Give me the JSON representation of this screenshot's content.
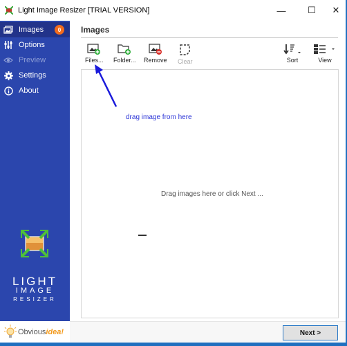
{
  "window": {
    "title": "Light Image Resizer  [TRIAL VERSION]",
    "controls": {
      "minimize": "—",
      "maximize": "☐",
      "close": "✕"
    }
  },
  "sidebar": {
    "items": [
      {
        "label": "Images",
        "icon": "images-icon",
        "active": true,
        "badge": "0"
      },
      {
        "label": "Options",
        "icon": "sliders-icon"
      },
      {
        "label": "Preview",
        "icon": "eye-icon",
        "disabled": true
      },
      {
        "label": "Settings",
        "icon": "gear-icon"
      },
      {
        "label": "About",
        "icon": "info-icon"
      }
    ],
    "logo": {
      "line1": "LIGHT",
      "line2": "IMAGE",
      "line3": "RESIZER"
    },
    "brand": {
      "part1": "Obvious",
      "part2": "idea!"
    }
  },
  "main": {
    "title": "Images",
    "toolbar": {
      "files": "Files...",
      "folder": "Folder...",
      "remove": "Remove",
      "clear": "Clear",
      "sort": "Sort",
      "view": "View"
    },
    "drop_message": "Drag images here or click Next ...",
    "annotation": "drag image from here",
    "next_label": "Next >"
  },
  "colors": {
    "sidebar": "#2b46ad",
    "sidebar_active": "#22338a",
    "badge": "#f26b1d",
    "annotation": "#2a33d6",
    "accent": "#2b79c7"
  }
}
